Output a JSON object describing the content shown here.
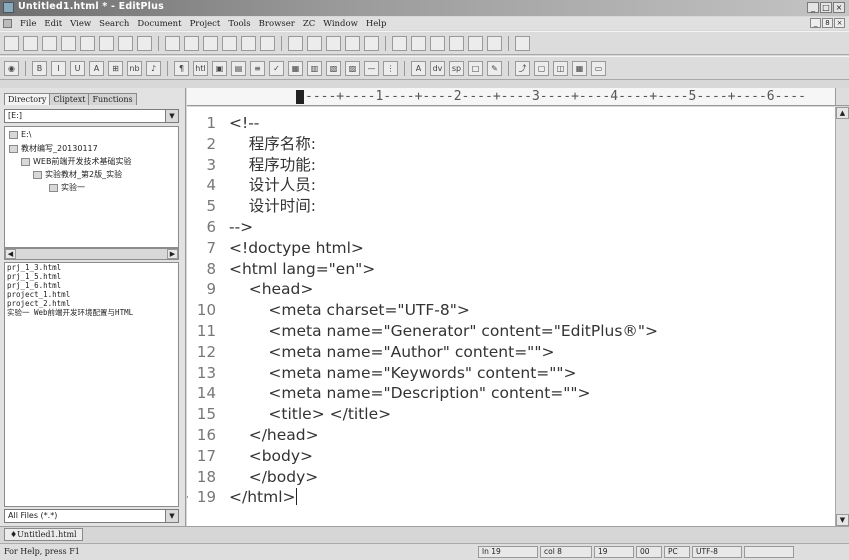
{
  "window": {
    "title": "Untitled1.html * - EditPlus",
    "controls": [
      "_",
      "□",
      "×"
    ]
  },
  "menu": {
    "items": [
      "File",
      "Edit",
      "View",
      "Search",
      "Document",
      "Project",
      "Tools",
      "Browser",
      "ZC",
      "Window",
      "Help"
    ],
    "mdi_controls": [
      "_",
      "8",
      "×"
    ]
  },
  "toolbar1": {
    "icons": [
      "new-file-icon",
      "open-icon",
      "save-icon",
      "save-all-icon",
      "print-icon",
      "print-preview-icon",
      "spell-check-icon",
      "browser-preview-icon",
      "cut-icon",
      "copy-icon",
      "paste-icon",
      "delete-icon",
      "undo-icon",
      "redo-icon",
      "find-icon",
      "replace-icon",
      "goto-icon",
      "word-wrap-icon",
      "ruler-icon",
      "line-number-icon",
      "column-icon",
      "check-icon",
      "window-icon",
      "split-icon",
      "full-screen-icon",
      "help-icon"
    ]
  },
  "toolbar2": {
    "glyphs": [
      "◉",
      "B",
      "I",
      "U",
      "A",
      "⊞",
      "nb",
      "♪",
      "¶",
      "htl",
      "▣",
      "▤",
      "≡",
      "✓",
      "▦",
      "▥",
      "▧",
      "▨",
      "—",
      "⋮",
      "A",
      "dv",
      "sp",
      "□",
      "✎",
      "⤴",
      "▢",
      "◫",
      "▦",
      "▭"
    ]
  },
  "sidebar": {
    "tabs": [
      "Directory",
      "Cliptext",
      "Functions"
    ],
    "drive": "[E:]",
    "tree": [
      "E:\\",
      "教材编写_20130117",
      "WEB前端开发技术基础实验",
      "实验教材_第2版_实验",
      "实验一"
    ],
    "files": [
      "prj_1_3.html",
      "prj_1_5.html",
      "prj_1_6.html",
      "project_1.html",
      "project_2.html",
      "实验一 Web前端开发环境配置与HTML"
    ],
    "filter": "All Files (*.*)"
  },
  "ruler": {
    "text": "----+----1----+----2----+----3----+----4----+----5----+----6----"
  },
  "editor": {
    "lines": [
      {
        "n": "1",
        "text": "<!--"
      },
      {
        "n": "2",
        "text": "    程序名称:"
      },
      {
        "n": "3",
        "text": "    程序功能:"
      },
      {
        "n": "4",
        "text": "    设计人员:"
      },
      {
        "n": "5",
        "text": "    设计时间:"
      },
      {
        "n": "6",
        "text": "-->"
      },
      {
        "n": "7",
        "text": "<!doctype html>"
      },
      {
        "n": "8",
        "text": "<html lang=\"en\">"
      },
      {
        "n": "9",
        "text": "    <head>"
      },
      {
        "n": "10",
        "text": "        <meta charset=\"UTF-8\">"
      },
      {
        "n": "11",
        "text": "        <meta name=\"Generator\" content=\"EditPlus®\">"
      },
      {
        "n": "12",
        "text": "        <meta name=\"Author\" content=\"\">"
      },
      {
        "n": "13",
        "text": "        <meta name=\"Keywords\" content=\"\">"
      },
      {
        "n": "14",
        "text": "        <meta name=\"Description\" content=\"\">"
      },
      {
        "n": "15",
        "text": "        <title> </title>"
      },
      {
        "n": "16",
        "text": "    </head>"
      },
      {
        "n": "17",
        "text": "    <body>"
      },
      {
        "n": "18",
        "text": "    </body>"
      },
      {
        "n": "19",
        "text": "</html>"
      }
    ]
  },
  "doctab": {
    "label": "♦Untitled1.html"
  },
  "status": {
    "help": "For Help, press F1",
    "line": "ln 19",
    "col": "col 8",
    "total": "19",
    "mode1": "00",
    "mode2": "PC",
    "encoding": "UTF-8"
  }
}
